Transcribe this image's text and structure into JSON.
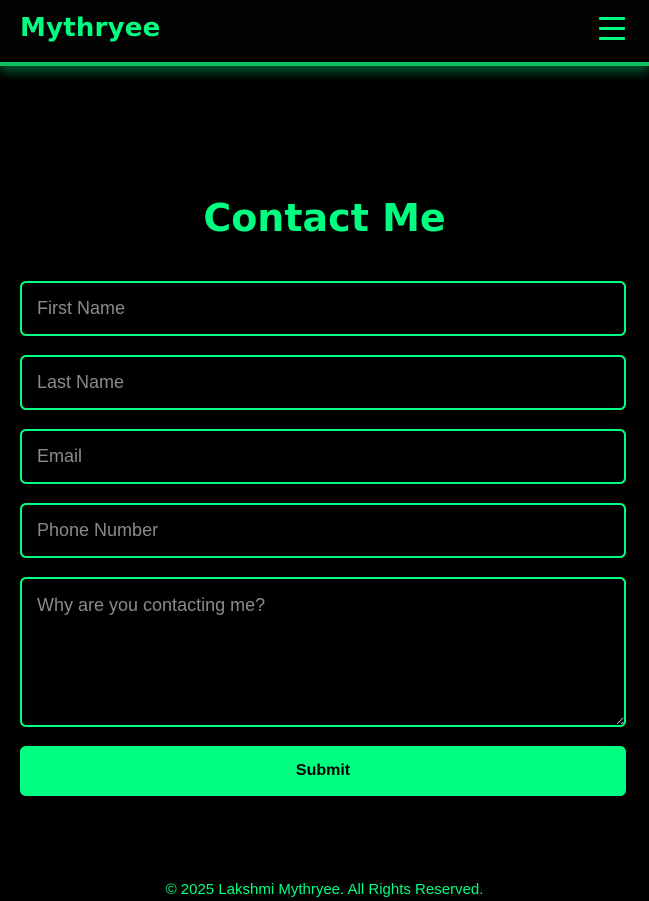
{
  "header": {
    "brand": "Mythryee",
    "menu_icon": "hamburger-menu-icon"
  },
  "main": {
    "title": "Contact Me"
  },
  "form": {
    "first_name": {
      "placeholder": "First Name",
      "value": ""
    },
    "last_name": {
      "placeholder": "Last Name",
      "value": ""
    },
    "email": {
      "placeholder": "Email",
      "value": ""
    },
    "phone": {
      "placeholder": "Phone Number",
      "value": ""
    },
    "message": {
      "placeholder": "Why are you contacting me?",
      "value": ""
    },
    "submit_label": "Submit"
  },
  "footer": {
    "copyright": "© 2025 Lakshmi Mythryee. All Rights Reserved."
  },
  "colors": {
    "accent": "#00ff80",
    "background": "#000000",
    "placeholder": "#8a8a8a"
  }
}
